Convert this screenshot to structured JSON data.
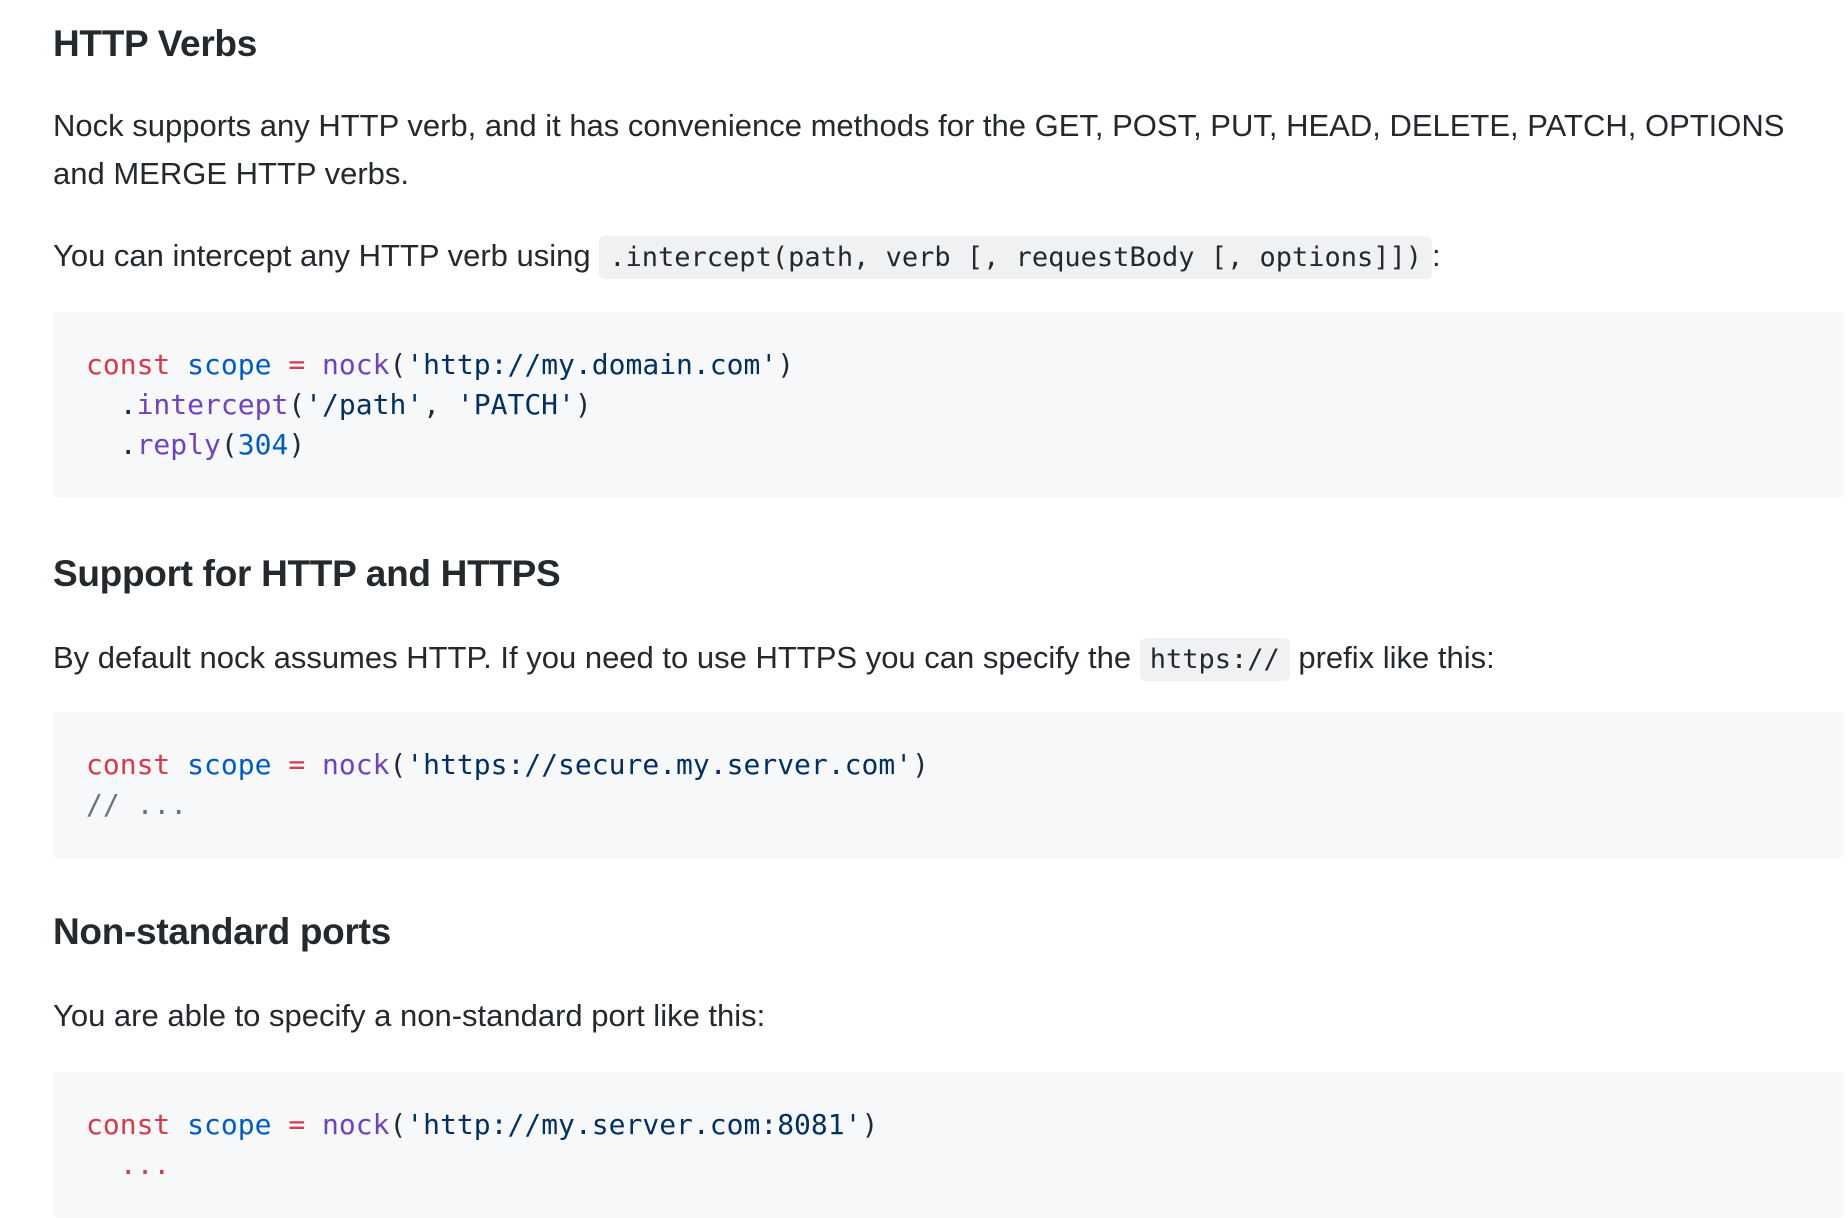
{
  "sections": {
    "verbs": {
      "heading": "HTTP Verbs",
      "paragraph1": "Nock supports any HTTP verb, and it has convenience methods for the GET, POST, PUT, HEAD, DELETE, PATCH, OPTIONS and MERGE HTTP verbs.",
      "paragraph2_before": "You can intercept any HTTP verb using ",
      "paragraph2_code": ".intercept(path, verb [, requestBody [, options]])",
      "paragraph2_after": ":",
      "code": {
        "line1": {
          "kw": "const",
          "var": "scope",
          "op": "=",
          "fn": "nock",
          "open": "(",
          "str": "'http://my.domain.com'",
          "close": ")"
        },
        "line2": {
          "indent": "  .",
          "fn": "intercept",
          "open": "(",
          "str1": "'/path'",
          "comma": ", ",
          "str2": "'PATCH'",
          "close": ")"
        },
        "line3": {
          "indent": "  .",
          "fn": "reply",
          "open": "(",
          "num": "304",
          "close": ")"
        }
      }
    },
    "https": {
      "heading": "Support for HTTP and HTTPS",
      "paragraph_before": "By default nock assumes HTTP. If you need to use HTTPS you can specify the ",
      "paragraph_code": "https://",
      "paragraph_after": " prefix like this:",
      "code": {
        "line1": {
          "kw": "const",
          "var": "scope",
          "op": "=",
          "fn": "nock",
          "open": "(",
          "str": "'https://secure.my.server.com'",
          "close": ")"
        },
        "line2": {
          "comment": "// ..."
        }
      }
    },
    "ports": {
      "heading": "Non-standard ports",
      "paragraph": "You are able to specify a non-standard port like this:",
      "code": {
        "line1": {
          "kw": "const",
          "var": "scope",
          "op": "=",
          "fn": "nock",
          "open": "(",
          "str": "'http://my.server.com:8081'",
          "close": ")"
        },
        "line2": {
          "indent": "  ",
          "ellipsis": "..."
        }
      }
    }
  }
}
